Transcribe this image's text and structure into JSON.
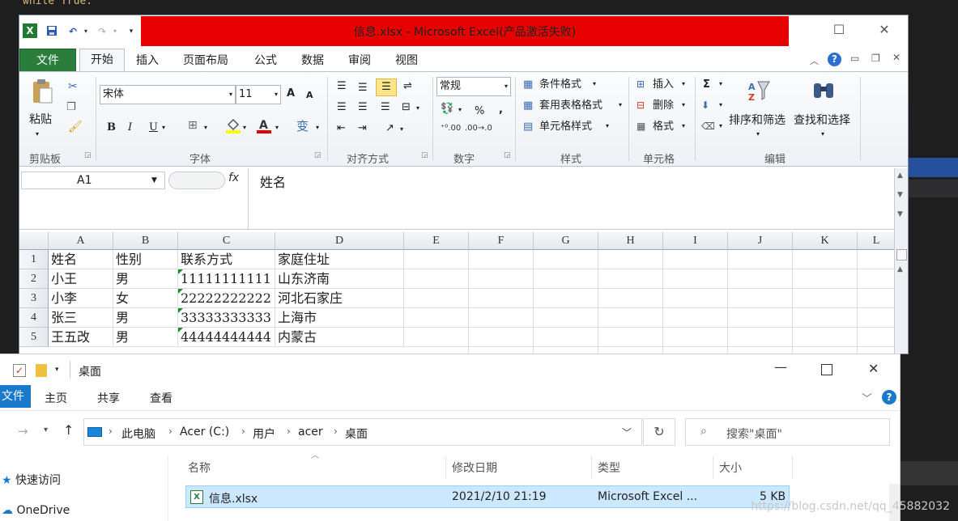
{
  "editor": {
    "code_line": "while True:"
  },
  "excel": {
    "window_title": "信息.xlsx - Microsoft Excel(产品激活失败)",
    "tabs": {
      "file": "文件",
      "home": "开始",
      "insert": "插入",
      "layout": "页面布局",
      "formulas": "公式",
      "data": "数据",
      "review": "审阅",
      "view": "视图"
    },
    "ribbon": {
      "clipboard": {
        "paste": "粘贴",
        "label": "剪贴板"
      },
      "font": {
        "name": "宋体",
        "size": "11",
        "bold": "B",
        "italic": "I",
        "underline": "U",
        "grow": "A",
        "shrink": "A",
        "label": "字体",
        "phonetic": "变"
      },
      "alignment": {
        "label": "对齐方式"
      },
      "number": {
        "format": "常规",
        "percent": "%",
        "comma": ",",
        "label": "数字"
      },
      "styles": {
        "conditional": "条件格式",
        "table": "套用表格格式",
        "cell": "单元格样式",
        "label": "样式"
      },
      "cells": {
        "insert": "插入",
        "delete": "删除",
        "format": "格式",
        "label": "单元格"
      },
      "editing": {
        "sum": "Σ",
        "sort": "排序和筛选",
        "find": "查找和选择",
        "label": "编辑"
      }
    },
    "formula_bar": {
      "name_box": "A1",
      "fx": "fx",
      "content": "姓名"
    },
    "columns": [
      "A",
      "B",
      "C",
      "D",
      "E",
      "F",
      "G",
      "H",
      "I",
      "J",
      "K",
      "L"
    ],
    "rows": [
      {
        "num": "1",
        "a": "姓名",
        "b": "性别",
        "c": "联系方式",
        "d": "家庭住址"
      },
      {
        "num": "2",
        "a": "小王",
        "b": "男",
        "c": "11111111111",
        "d": "山东济南"
      },
      {
        "num": "3",
        "a": "小李",
        "b": "女",
        "c": "22222222222",
        "d": "河北石家庄"
      },
      {
        "num": "4",
        "a": "张三",
        "b": "男",
        "c": "33333333333",
        "d": "上海市"
      },
      {
        "num": "5",
        "a": "王五改",
        "b": "男",
        "c": "44444444444",
        "d": "内蒙古"
      }
    ]
  },
  "explorer": {
    "title": "桌面",
    "tabs": {
      "file": "文件",
      "home": "主页",
      "share": "共享",
      "view": "查看"
    },
    "breadcrumb": [
      "此电脑",
      "Acer (C:)",
      "用户",
      "acer",
      "桌面"
    ],
    "search_placeholder": "搜索\"桌面\"",
    "nav": {
      "quick_access": "快速访问",
      "onedrive": "OneDrive"
    },
    "columns": {
      "name": "名称",
      "modified": "修改日期",
      "type": "类型",
      "size": "大小"
    },
    "files": [
      {
        "name": "信息.xlsx",
        "modified": "2021/2/10 21:19",
        "type": "Microsoft Excel ...",
        "size": "5 KB"
      }
    ]
  },
  "watermark": "https://blog.csdn.net/qq_45882032",
  "colors": {
    "excel_green": "#2b7d3b",
    "title_red": "#e60000",
    "explorer_blue": "#1979ca",
    "selected_row": "#cce8ff"
  }
}
